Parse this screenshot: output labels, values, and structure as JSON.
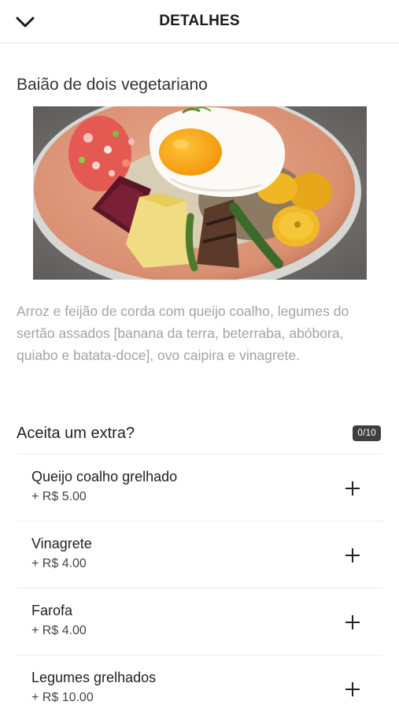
{
  "header": {
    "title": "DETALHES",
    "back_icon": "chevron-down-icon"
  },
  "product": {
    "name": "Baião de dois vegetariano",
    "description": "Arroz e feijão de corda com queijo coalho, legumes do sertão assados [banana da terra, beterraba, abóbora, quiabo e batata-doce], ovo caipira e vinagrete."
  },
  "extras": {
    "title": "Aceita um extra?",
    "counter": "0/10",
    "items": [
      {
        "name": "Queijo coalho grelhado",
        "price": "+ R$ 5.00",
        "icon": "plus-icon"
      },
      {
        "name": "Vinagrete",
        "price": "+ R$ 4.00",
        "icon": "plus-icon"
      },
      {
        "name": "Farofa",
        "price": "+ R$ 4.00",
        "icon": "plus-icon"
      },
      {
        "name": "Legumes grelhados",
        "price": "+ R$ 10.00",
        "icon": "plus-icon"
      }
    ]
  },
  "colors": {
    "counter_badge": "#3f3f3f",
    "description_text": "#a3a3a3",
    "divider": "#ececec"
  }
}
